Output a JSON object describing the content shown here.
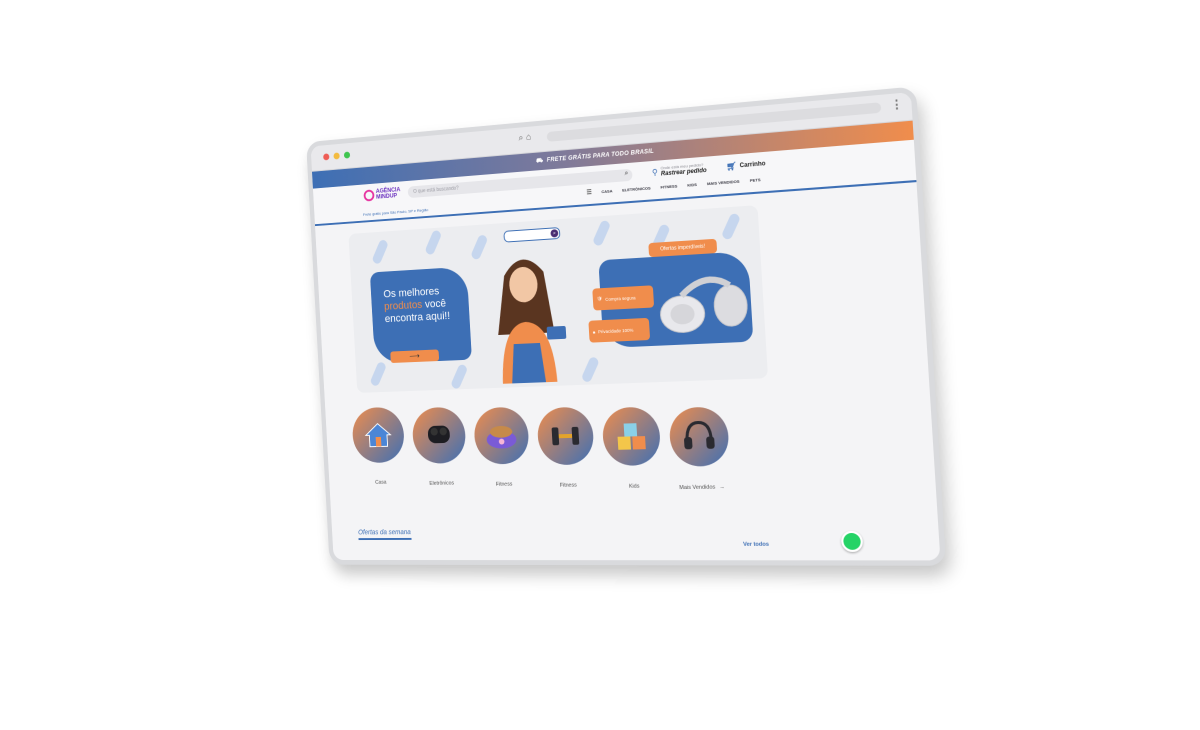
{
  "promo_bar": {
    "text": "FRETE GRÁTIS PARA TODO BRASIL"
  },
  "header": {
    "logo_line1": "AGÊNCIA",
    "logo_line2": "MINDUP",
    "search_placeholder": "O que está buscando?",
    "track_small": "Onde está meu pedido?",
    "track_label": "Rastrear pedido",
    "cart_label": "Carrinho",
    "shipping_note": "Frete grátis para São Paulo, SP e Região"
  },
  "nav": {
    "items": [
      "CASA",
      "ELETRÔNICOS",
      "FITNESS",
      "KIDS",
      "MAIS VENDIDOS",
      "PETS"
    ]
  },
  "hero": {
    "headline_1": "Os melhores",
    "headline_accent": "produtos",
    "headline_2": "você encontra aqui!!",
    "cta_arrow": "⟶",
    "offer_badge": "Ofertas imperdíveis!",
    "secure_label": "Compra segura",
    "privacy_label": "Privacidade 100%"
  },
  "categories": [
    {
      "label": "Casa",
      "icon": "house-icon"
    },
    {
      "label": "Eletrônicos",
      "icon": "earbuds-icon"
    },
    {
      "label": "Fitness",
      "icon": "pet-bowl-icon"
    },
    {
      "label": "Fitness",
      "icon": "dumbbell-icon"
    },
    {
      "label": "Kids",
      "icon": "abc-blocks-icon"
    },
    {
      "label": "Mais Vendidos",
      "icon": "headphones-icon"
    }
  ],
  "offers": {
    "title": "Ofertas da semana",
    "see_all": "Ver todos"
  },
  "colors": {
    "brand_blue": "#3d6fb5",
    "brand_orange": "#f08d4c",
    "whatsapp": "#25d366"
  }
}
